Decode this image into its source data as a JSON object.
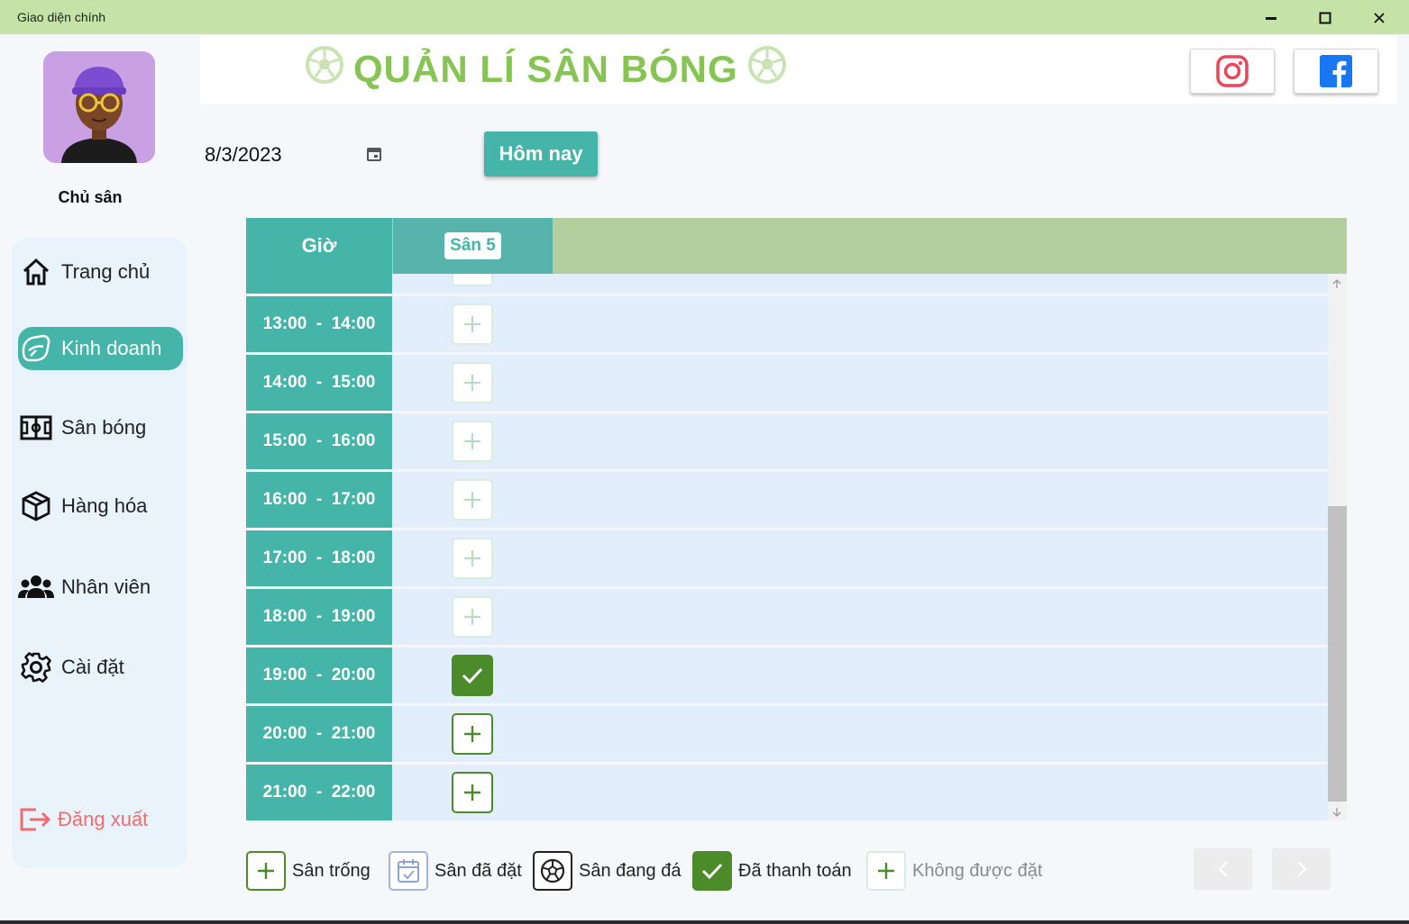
{
  "window": {
    "title": "Giao diện chính"
  },
  "sidebar": {
    "owner_label": "Chủ sân",
    "items": [
      {
        "label": "Trang chủ",
        "icon": "home-icon"
      },
      {
        "label": "Kinh doanh",
        "icon": "business-icon",
        "active": true
      },
      {
        "label": "Sân bóng",
        "icon": "field-icon"
      },
      {
        "label": "Hàng hóa",
        "icon": "box-icon"
      },
      {
        "label": "Nhân viên",
        "icon": "people-icon"
      },
      {
        "label": "Cài đặt",
        "icon": "gear-icon"
      }
    ],
    "logout_label": "Đăng xuất"
  },
  "header": {
    "title": "QUẢN LÍ SÂN BÓNG"
  },
  "date_picker": {
    "value": "8/3/2023"
  },
  "today_button": "Hôm nay",
  "table": {
    "hour_header": "Giờ",
    "court_header": "Sân 5",
    "rows": [
      {
        "time": "13:00  -  14:00",
        "status": "disabled"
      },
      {
        "time": "14:00  -  15:00",
        "status": "disabled"
      },
      {
        "time": "15:00  -  16:00",
        "status": "disabled"
      },
      {
        "time": "16:00  -  17:00",
        "status": "disabled"
      },
      {
        "time": "17:00  -  18:00",
        "status": "disabled"
      },
      {
        "time": "18:00  -  19:00",
        "status": "disabled"
      },
      {
        "time": "19:00  -  20:00",
        "status": "paid"
      },
      {
        "time": "20:00  -  21:00",
        "status": "empty"
      },
      {
        "time": "21:00  -  22:00",
        "status": "empty"
      }
    ]
  },
  "legend": {
    "empty": "Sân trống",
    "booked": "Sân đã đặt",
    "playing": "Sân đang đá",
    "paid": "Đã thanh toán",
    "disabled": "Không được đặt"
  },
  "colors": {
    "titlebar": "#c6e3a7",
    "accent_teal": "#45b5a9",
    "title_green": "#86c553",
    "paid_green": "#4b8b2a",
    "logout_red": "#f36d6d"
  }
}
